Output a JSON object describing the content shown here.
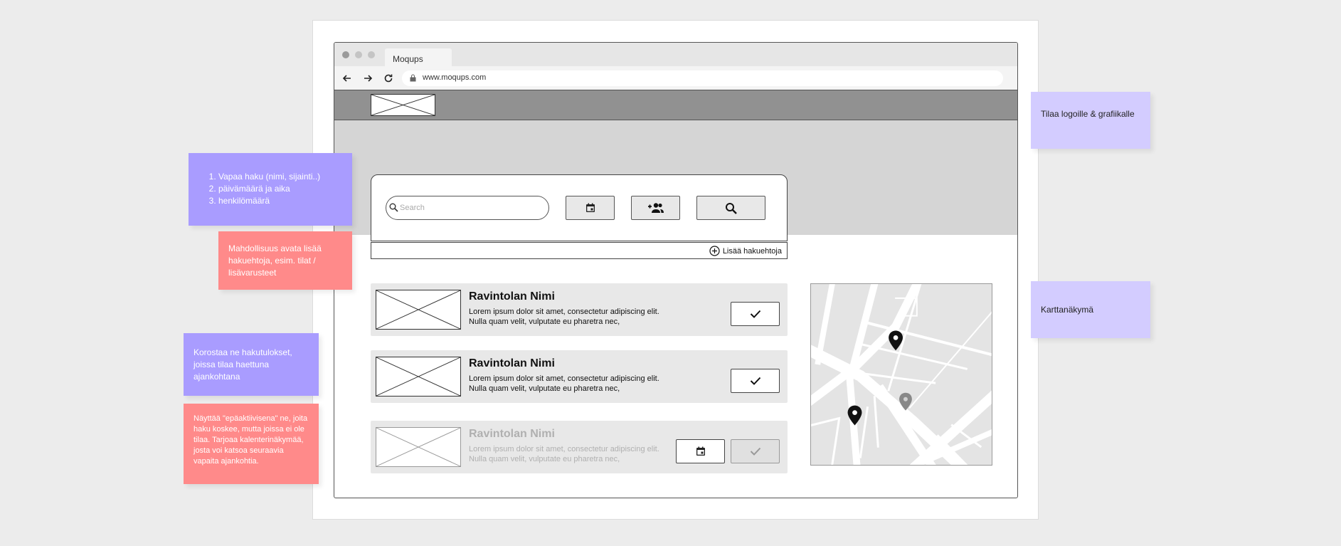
{
  "browser": {
    "tab_title": "Moqups",
    "url": "www.moqups.com"
  },
  "search": {
    "placeholder": "Search",
    "more_filters_label": "Lisää hakuehtoja"
  },
  "results": [
    {
      "title": "Ravintolan Nimi",
      "desc_line1": "Lorem ipsum dolor sit amet, consectetur adipiscing elit.",
      "desc_line2": "Nulla quam velit, vulputate eu pharetra nec,",
      "state": "active"
    },
    {
      "title": "Ravintolan Nimi",
      "desc_line1": "Lorem ipsum dolor sit amet, consectetur adipiscing elit.",
      "desc_line2": "Nulla quam velit, vulputate eu pharetra nec,",
      "state": "active"
    },
    {
      "title": "Ravintolan Nimi",
      "desc_line1": "Lorem ipsum dolor sit amet, consectetur adipiscing elit.",
      "desc_line2": "Nulla quam velit, vulputate eu pharetra nec,",
      "state": "inactive"
    }
  ],
  "notes": {
    "search_fields": [
      "Vapaa haku (nimi, sijainti..)",
      "päivämäärä ja aika",
      "henkilömäärä"
    ],
    "more_filters": "Mahdollisuus avata lisää hakuehtoja, esim. tilat / lisävarusteet",
    "highlight": "Korostaa ne hakutulokset, joissa tilaa haettuna ajankohtana",
    "inactive": "Näyttää \"epäaktiivisena\" ne, joita haku koskee, mutta joissa ei ole tilaa. Tarjoaa kalenterinäkymää, josta voi katsoa seuraavia vapaita ajankohtia.",
    "logo_space": "Tilaa logoille & grafiikalle",
    "map_view": "Karttanäkymä"
  },
  "colors": {
    "note_purple": "#a99cff",
    "note_red": "#ff8a8a",
    "note_lilac": "#d3ccff",
    "header_gray": "#919191",
    "hero_gray": "#d5d5d5"
  }
}
